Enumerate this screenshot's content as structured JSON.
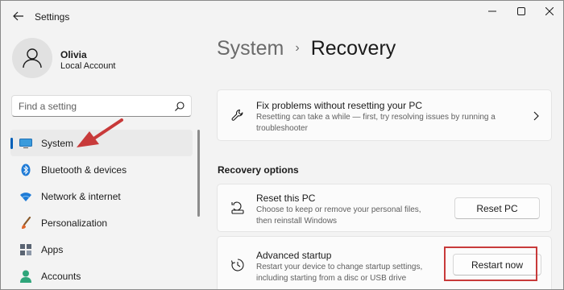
{
  "app": {
    "title": "Settings"
  },
  "window_controls": {
    "minimize": "minimize-icon",
    "maximize": "maximize-icon",
    "close": "close-icon"
  },
  "user": {
    "name": "Olivia",
    "account_type": "Local Account"
  },
  "search": {
    "placeholder": "Find a setting",
    "icon": "search-icon"
  },
  "sidebar": {
    "items": [
      {
        "label": "System",
        "icon": "monitor-icon",
        "active": true
      },
      {
        "label": "Bluetooth & devices",
        "icon": "bluetooth-icon"
      },
      {
        "label": "Network & internet",
        "icon": "wifi-icon"
      },
      {
        "label": "Personalization",
        "icon": "brush-icon"
      },
      {
        "label": "Apps",
        "icon": "apps-icon"
      },
      {
        "label": "Accounts",
        "icon": "person-icon"
      }
    ]
  },
  "breadcrumb": {
    "parent": "System",
    "separator": "›",
    "current": "Recovery"
  },
  "fix_card": {
    "title": "Fix problems without resetting your PC",
    "description_line1": "Resetting can take a while — first, try resolving issues by running a",
    "description_line2": "troubleshooter"
  },
  "recovery_options": {
    "heading": "Recovery options",
    "reset": {
      "title": "Reset this PC",
      "description_line1": "Choose to keep or remove your personal files,",
      "description_line2": "then reinstall Windows",
      "button": "Reset PC"
    },
    "advanced": {
      "title": "Advanced startup",
      "description_line1": "Restart your device to change startup settings,",
      "description_line2": "including starting from a disc or USB drive",
      "button": "Restart now"
    }
  },
  "colors": {
    "accent": "#005fb8",
    "annotation_red": "#c83a3a",
    "background": "#f3f3f3",
    "card": "#fbfbfb"
  }
}
